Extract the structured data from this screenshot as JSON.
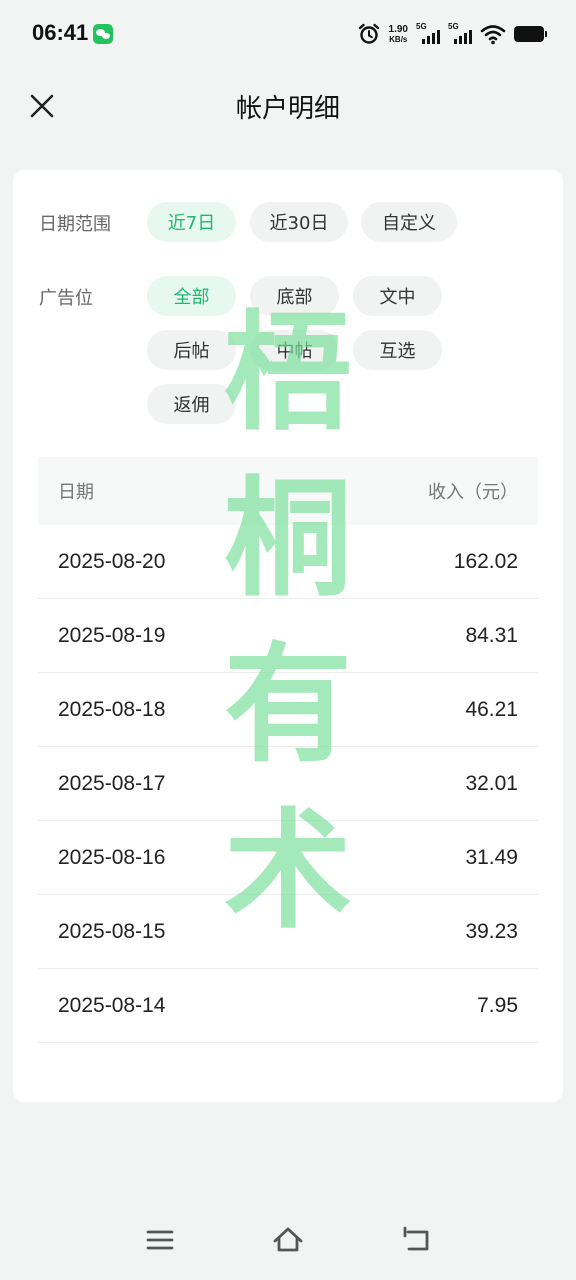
{
  "status_bar": {
    "time": "06:41",
    "net_speed_value": "1.90",
    "net_speed_unit": "KB/s",
    "sim1": "5G",
    "sim2": "5G"
  },
  "header": {
    "title": "帐户明细"
  },
  "filters": {
    "date_range": {
      "label": "日期范围",
      "options": [
        "近7日",
        "近30日",
        "自定义"
      ],
      "selected": "近7日"
    },
    "ad_slot": {
      "label": "广告位",
      "options": [
        "全部",
        "底部",
        "文中",
        "后帖",
        "中帖",
        "互选",
        "返佣"
      ],
      "selected": "全部"
    }
  },
  "table": {
    "headers": [
      "日期",
      "收入（元）"
    ],
    "rows": [
      {
        "date": "2025-08-20",
        "income": "162.02"
      },
      {
        "date": "2025-08-19",
        "income": "84.31"
      },
      {
        "date": "2025-08-18",
        "income": "46.21"
      },
      {
        "date": "2025-08-17",
        "income": "32.01"
      },
      {
        "date": "2025-08-16",
        "income": "31.49"
      },
      {
        "date": "2025-08-15",
        "income": "39.23"
      },
      {
        "date": "2025-08-14",
        "income": "7.95"
      }
    ]
  },
  "watermark": [
    "梧",
    "桐",
    "有",
    "术"
  ],
  "colors": {
    "accent": "#1fb872",
    "accent_bg": "#e6f8ef",
    "watermark": "#78de98",
    "page_bg": "#f2f4f3"
  },
  "icons": {
    "close": "close-icon",
    "alarm": "alarm-icon",
    "wifi": "wifi-icon",
    "battery": "battery-icon",
    "menu": "menu-icon",
    "home": "home-icon",
    "back": "back-icon"
  }
}
